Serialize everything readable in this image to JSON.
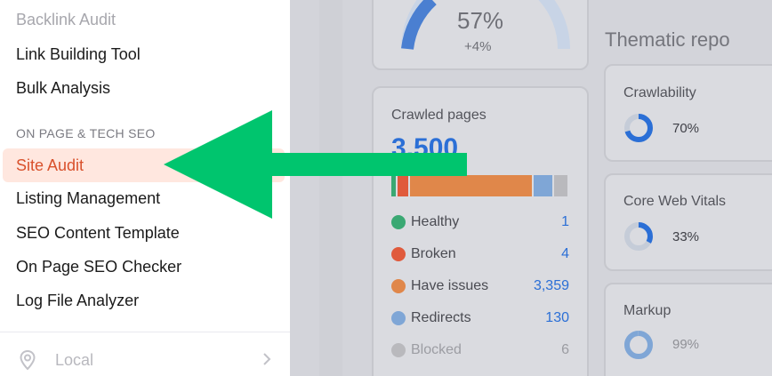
{
  "menu": {
    "items_top": [
      {
        "label": "Backlink Audit"
      },
      {
        "label": "Link Building Tool"
      },
      {
        "label": "Bulk Analysis"
      }
    ],
    "section_heading": "ON PAGE & TECH SEO",
    "active_item": "Site Audit",
    "items_section": [
      {
        "label": "Listing Management"
      },
      {
        "label": "SEO Content Template"
      },
      {
        "label": "On Page SEO Checker"
      },
      {
        "label": "Log File Analyzer"
      }
    ],
    "local": {
      "label": "Local",
      "icon": "location-pin-icon",
      "chevron": "chevron-right-icon"
    }
  },
  "dashboard": {
    "gauge": {
      "percent": "57%",
      "delta": "+4%"
    },
    "thematic_title": "Thematic repo",
    "crawled": {
      "title": "Crawled pages",
      "total": "3,500",
      "bar_segments": [
        {
          "name": "Healthy",
          "color": "#3aa873",
          "fraction": 0.025
        },
        {
          "name": "Broken",
          "color": "#e05a3c",
          "fraction": 0.06
        },
        {
          "name": "Have issues",
          "color": "#e0874a",
          "fraction": 0.66
        },
        {
          "name": "Redirects",
          "color": "#7fa6d6",
          "fraction": 0.1
        },
        {
          "name": "Blocked",
          "color": "#b9b9bd",
          "fraction": 0.07
        }
      ],
      "legend": [
        {
          "name": "Healthy",
          "value": "1",
          "color": "#3aa873"
        },
        {
          "name": "Broken",
          "value": "4",
          "color": "#e05a3c"
        },
        {
          "name": "Have issues",
          "value": "3,359",
          "color": "#e0874a"
        },
        {
          "name": "Redirects",
          "value": "130",
          "color": "#7fa6d6"
        },
        {
          "name": "Blocked",
          "value": "6",
          "color": "#b9b9bd"
        }
      ]
    },
    "thematic": [
      {
        "label": "Crawlability",
        "percent": "70%",
        "fraction": 0.7,
        "color": "#2b6fd6"
      },
      {
        "label": "Core Web Vitals",
        "percent": "33%",
        "fraction": 0.33,
        "color": "#2b6fd6"
      },
      {
        "label": "Markup",
        "percent": "99%",
        "fraction": 0.99,
        "color": "#7fa6d6"
      }
    ]
  },
  "colors": {
    "arrow": "#00c56e",
    "active_text": "#d9512c",
    "active_bg": "#ffe7df",
    "accent_blue": "#2b6fd6"
  }
}
